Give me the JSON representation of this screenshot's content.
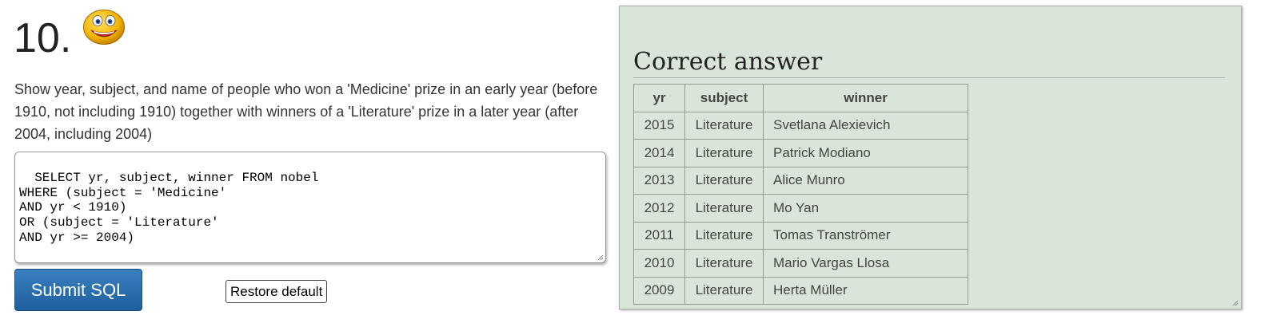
{
  "question": {
    "number": "10.",
    "text": "Show year, subject, and name of people who won a 'Medicine' prize in an early year (before 1910, not including 1910) together with winners of a 'Literature' prize in a later year (after 2004, including 2004)",
    "status_icon": "smiley-face-icon"
  },
  "editor": {
    "sql": "SELECT yr, subject, winner FROM nobel\nWHERE (subject = 'Medicine'\nAND yr < 1910)\nOR (subject = 'Literature'\nAND yr >= 2004)"
  },
  "buttons": {
    "submit_label": "Submit SQL",
    "restore_label": "Restore default"
  },
  "answer": {
    "title": "Correct answer",
    "columns": [
      "yr",
      "subject",
      "winner"
    ],
    "rows": [
      [
        "2015",
        "Literature",
        "Svetlana Alexievich"
      ],
      [
        "2014",
        "Literature",
        "Patrick Modiano"
      ],
      [
        "2013",
        "Literature",
        "Alice Munro"
      ],
      [
        "2012",
        "Literature",
        "Mo Yan"
      ],
      [
        "2011",
        "Literature",
        "Tomas Tranströmer"
      ],
      [
        "2010",
        "Literature",
        "Mario Vargas Llosa"
      ],
      [
        "2009",
        "Literature",
        "Herta Müller"
      ]
    ]
  },
  "colors": {
    "panel_background": "#dae5da",
    "submit_button": "#2a6fb0",
    "smiley": "#f5b400"
  }
}
